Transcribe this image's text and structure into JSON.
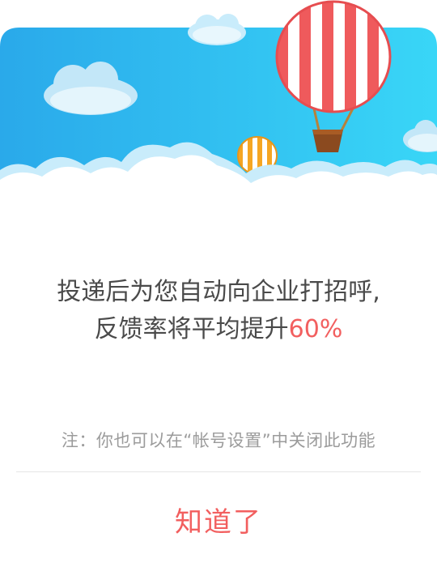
{
  "colors": {
    "sky_top": "#2aa9ea",
    "sky_bottom": "#39d6f7",
    "accent": "#f25f5f",
    "text": "#4a4a4a",
    "note_text": "#9b9b9b",
    "divider": "#e6e6e6"
  },
  "banner": {
    "icons": [
      "cloud-icon",
      "hot-air-balloon-icon"
    ]
  },
  "message": {
    "line1": "投递后为您自动向企业打招呼,",
    "line2_prefix": "反馈率将平均提升",
    "line2_highlight": "60%"
  },
  "note": "注：你也可以在“帐号设置”中关闭此功能",
  "confirm_label": "知道了"
}
